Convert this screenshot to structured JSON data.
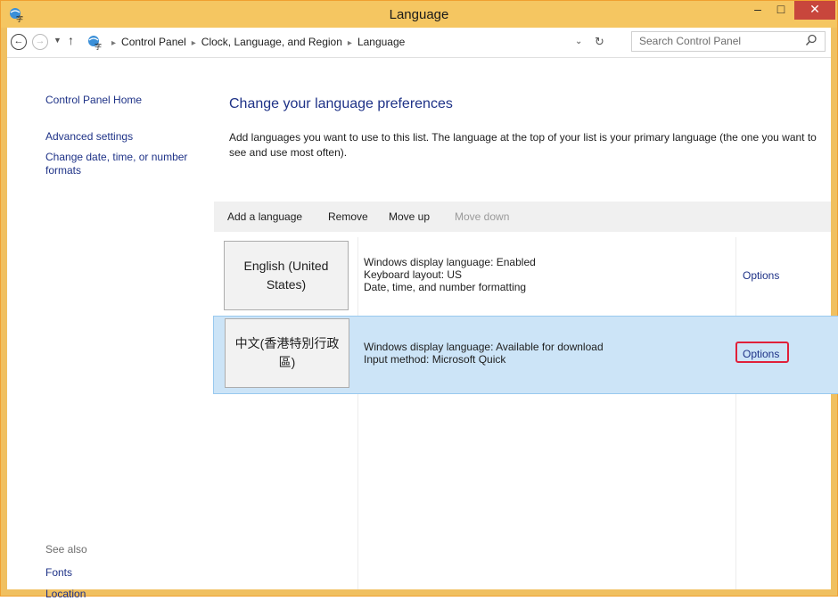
{
  "window": {
    "title": "Language",
    "minimize_glyph": "–",
    "maximize_glyph": "□",
    "close_glyph": "✕",
    "app_icon": "language-icon"
  },
  "address": {
    "crumbs": [
      "Control Panel",
      "Clock, Language, and Region",
      "Language"
    ],
    "search_placeholder": "Search Control Panel",
    "back_glyph": "←",
    "forward_glyph": "→",
    "up_glyph": "↑",
    "refresh_glyph": "↻",
    "dropdown_glyph": "⌄"
  },
  "sidebar": {
    "home": "Control Panel Home",
    "advanced": "Advanced settings",
    "date_formats": "Change date, time, or number formats",
    "see_also": "See also",
    "fonts": "Fonts",
    "location": "Location"
  },
  "main": {
    "heading": "Change your language preferences",
    "description": "Add languages you want to use to this list. The language at the top of your list is your primary language (the one you want to see and use most often).",
    "toolbar": {
      "add": "Add a language",
      "remove": "Remove",
      "move_up": "Move up",
      "move_down": "Move down"
    },
    "languages": [
      {
        "name": "English (United States)",
        "lines": [
          "Windows display language: Enabled",
          "Keyboard layout: US",
          "Date, time, and number formatting"
        ],
        "options": "Options",
        "selected": false
      },
      {
        "name": "中文(香港特別行政區)",
        "lines": [
          "Windows display language: Available for download",
          "Input method: Microsoft Quick"
        ],
        "options": "Options",
        "selected": true
      }
    ]
  },
  "colors": {
    "titlebar": "#f5c661",
    "close": "#c8463c",
    "link": "#1e3287",
    "selection": "#cce4f7",
    "highlight": "#e0203a"
  }
}
